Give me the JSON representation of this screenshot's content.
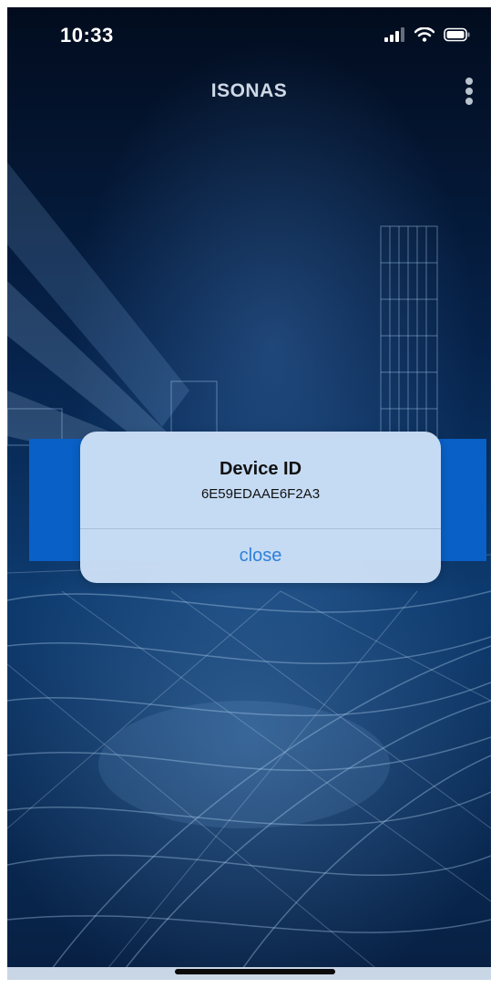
{
  "status_bar": {
    "time": "10:33",
    "icons": [
      "signal-icon",
      "wifi-icon",
      "battery-icon"
    ]
  },
  "header": {
    "title": "ISONAS",
    "menu_icon": "more-vertical-icon"
  },
  "dialog": {
    "title": "Device ID",
    "message": "6E59EDAAE6F2A3",
    "close_label": "close"
  },
  "colors": {
    "accent": "#2f7fd9",
    "band": "#0960c6",
    "background": "#06224a",
    "dialog_background": "#cde0f6"
  }
}
